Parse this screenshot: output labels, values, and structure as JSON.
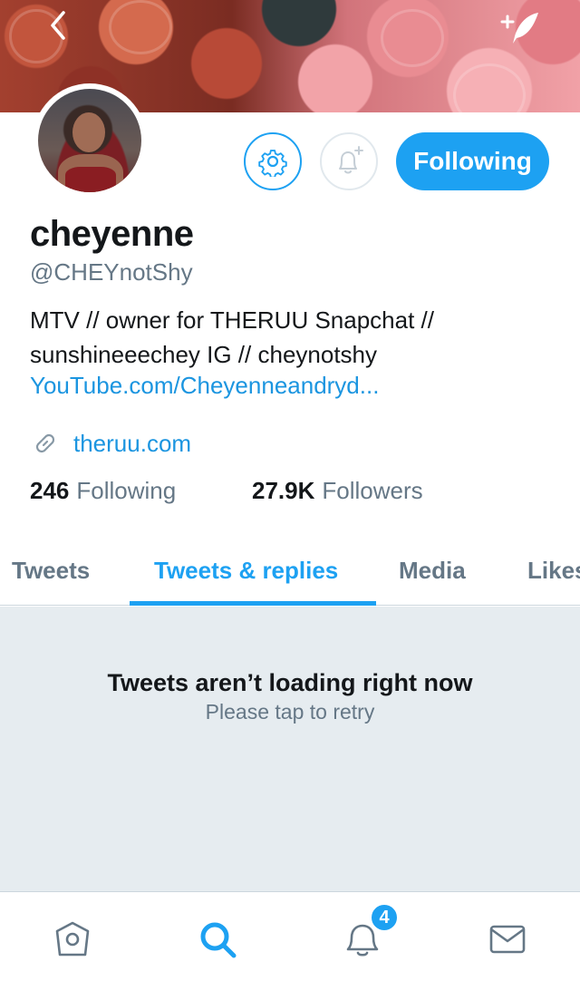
{
  "profile": {
    "name": "cheyenne",
    "handle": "@CHEYnotShy",
    "bio_line1": "MTV // owner for THERUU Snapchat //",
    "bio_line2": "sunshineeechey IG // cheynotshy",
    "bio_link": "YouTube.com/Cheyenneandryd...",
    "website": "theruu.com",
    "following_count": "246",
    "following_label": "Following",
    "followers_count": "27.9K",
    "followers_label": "Followers"
  },
  "actions": {
    "follow_label": "Following"
  },
  "tabs": [
    {
      "label": "Tweets"
    },
    {
      "label": "Tweets & replies"
    },
    {
      "label": "Media"
    },
    {
      "label": "Likes"
    }
  ],
  "feed": {
    "error_title": "Tweets aren’t loading right now",
    "error_subtitle": "Please tap to retry"
  },
  "tabbar": {
    "notifications_badge": "4",
    "icons": [
      "home-icon",
      "search-icon",
      "notifications-icon",
      "messages-icon"
    ]
  },
  "colors": {
    "accent": "#1da1f2",
    "link": "#1b95e0",
    "secondary_text": "#657786",
    "feed_background": "#e6ecf0"
  }
}
